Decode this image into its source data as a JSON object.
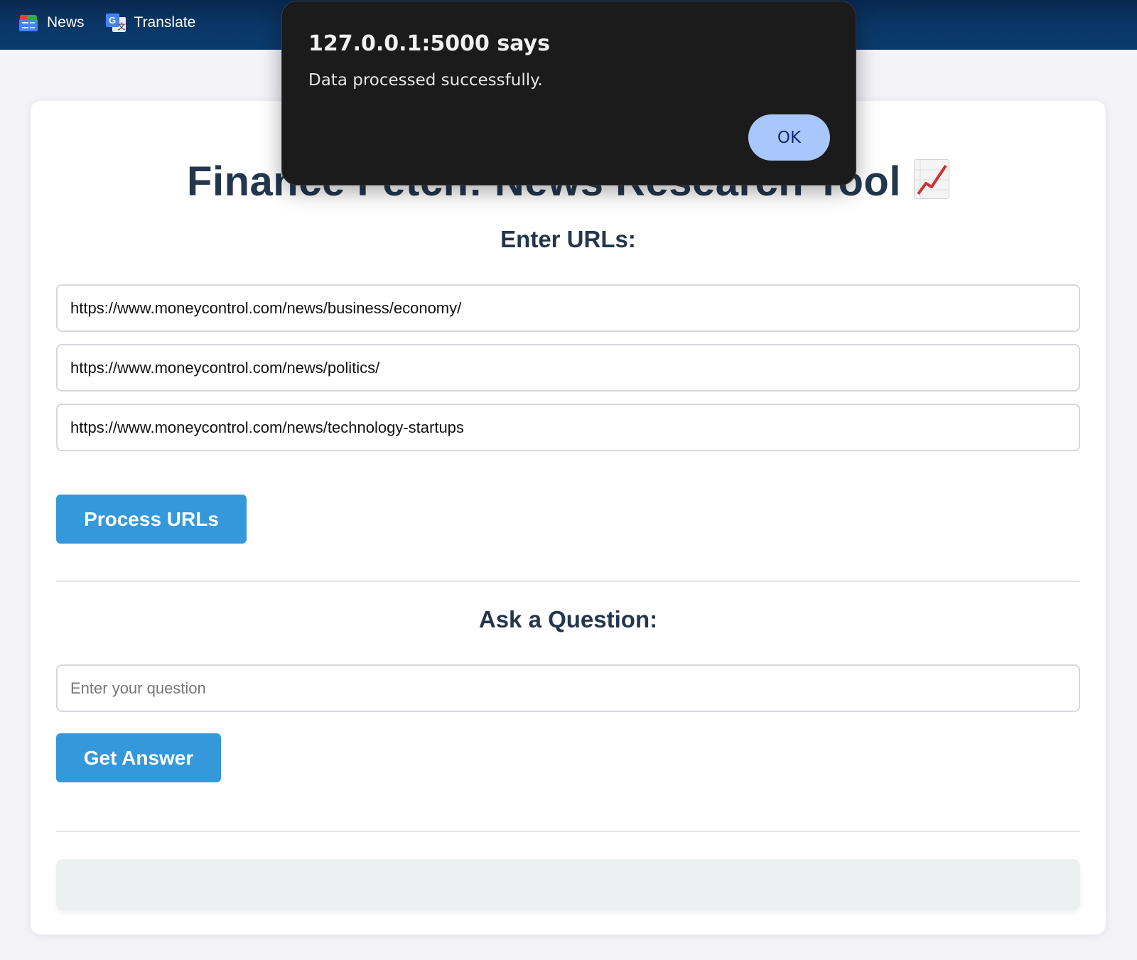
{
  "bookmarks": [
    {
      "label": "News",
      "icon": "google-news-icon"
    },
    {
      "label": "Translate",
      "icon": "google-translate-icon"
    }
  ],
  "page": {
    "title": "Finance Fetch: News Research Tool",
    "title_emoji": "chart-increasing-icon",
    "urls_heading": "Enter URLs:",
    "urls": [
      "https://www.moneycontrol.com/news/business/economy/",
      "https://www.moneycontrol.com/news/politics/",
      "https://www.moneycontrol.com/news/technology-startups"
    ],
    "process_button": "Process URLs",
    "question_heading": "Ask a Question:",
    "question_placeholder": "Enter your question",
    "question_value": "",
    "answer_button": "Get Answer",
    "result": ""
  },
  "alert": {
    "title": "127.0.0.1:5000 says",
    "message": "Data processed successfully.",
    "ok_label": "OK"
  },
  "colors": {
    "bookmarks_bar": "#0b3768",
    "title_text": "#24364c",
    "button": "#3498db",
    "result_box": "#ecf0f1",
    "alert_bg": "#1b1b1b",
    "alert_ok": "#a8c7fa"
  }
}
